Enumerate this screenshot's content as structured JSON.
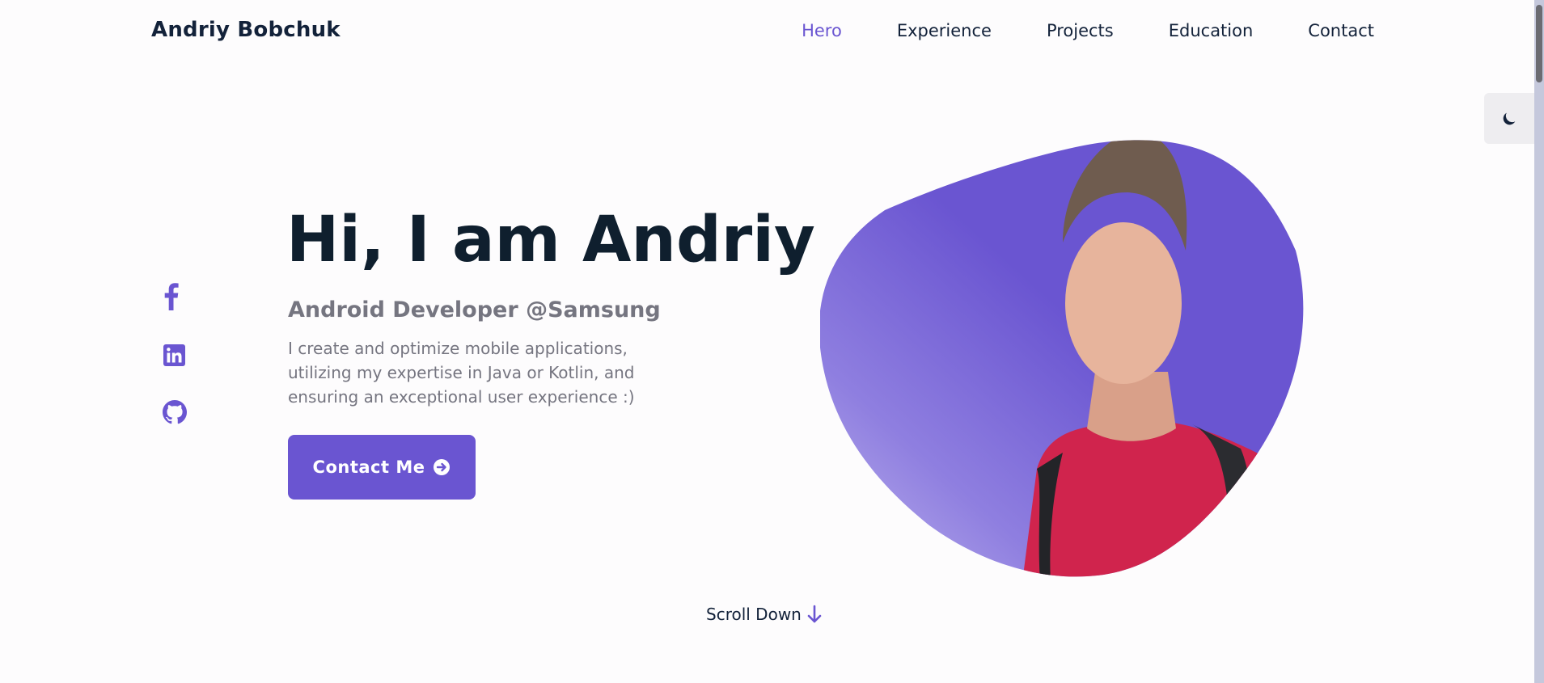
{
  "header": {
    "brand": "Andriy Bobchuk",
    "nav": [
      {
        "label": "Hero",
        "active": true
      },
      {
        "label": "Experience"
      },
      {
        "label": "Projects"
      },
      {
        "label": "Education"
      },
      {
        "label": "Contact"
      }
    ]
  },
  "theme_toggle": {
    "icon": "moon-icon"
  },
  "socials": [
    {
      "icon": "facebook-icon"
    },
    {
      "icon": "linkedin-icon"
    },
    {
      "icon": "github-icon"
    }
  ],
  "hero": {
    "title": "Hi, I am Andriy",
    "subtitle": "Android Developer @Samsung",
    "description": "I create and optimize mobile applications, utilizing my expertise in Java or Kotlin, and ensuring an exceptional user experience :)",
    "cta_label": "Contact Me",
    "cta_icon": "arrow-right-circle-icon",
    "image_icon": "profile-photo"
  },
  "scroll_down": {
    "label": "Scroll Down",
    "icon": "arrow-down-icon"
  },
  "colors": {
    "accent": "#6a55d1",
    "text_dark": "#0f1f2e",
    "text_muted": "#757580",
    "background": "#fdfcfd"
  }
}
